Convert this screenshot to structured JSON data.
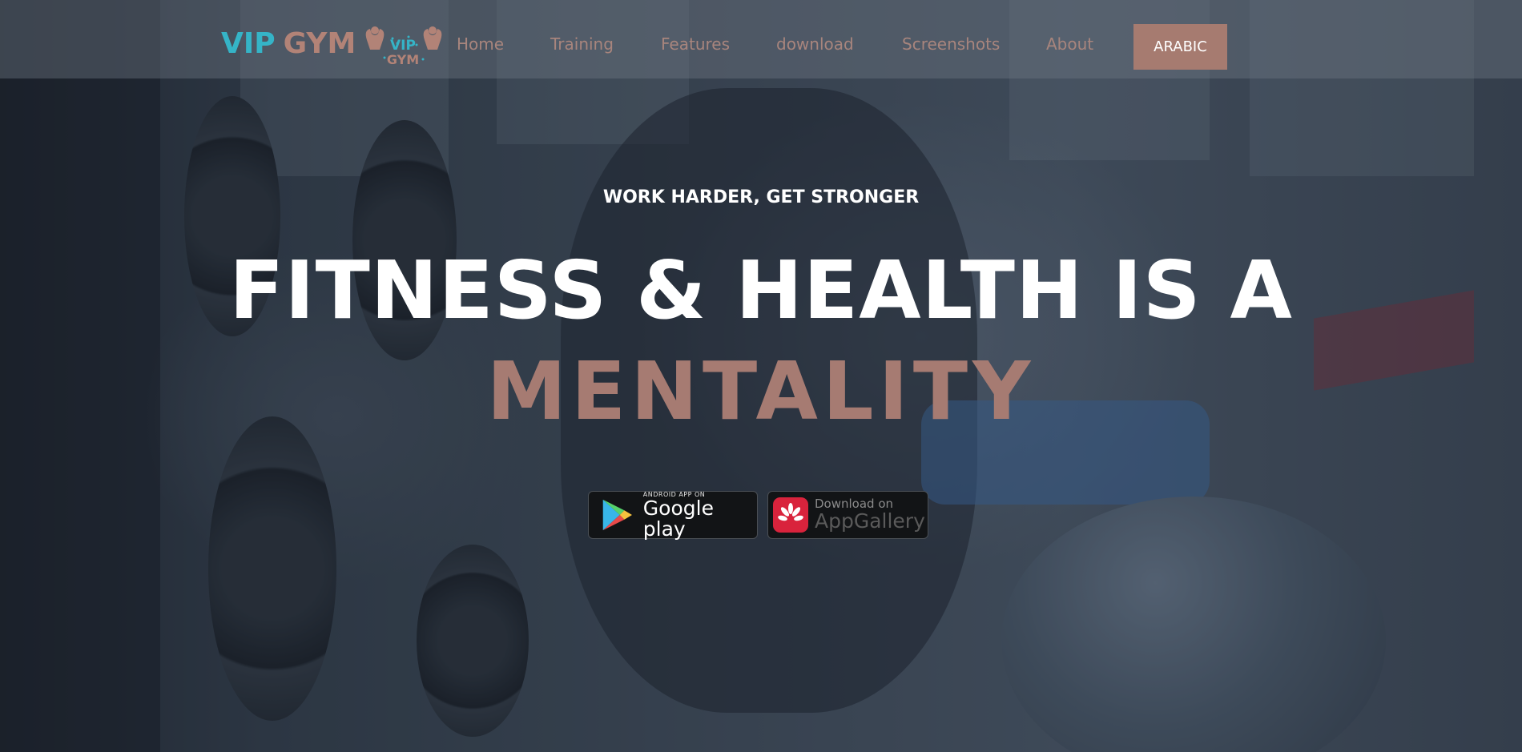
{
  "brand": {
    "name_part1": "VIP",
    "name_part2": "GYM",
    "logo_text_part1": "VIP",
    "logo_text_part2": "GYM"
  },
  "nav": {
    "items": [
      {
        "label": "Home"
      },
      {
        "label": "Training"
      },
      {
        "label": "Features"
      },
      {
        "label": "download"
      },
      {
        "label": "Screenshots"
      },
      {
        "label": "About"
      }
    ],
    "language_button": "ARABIC"
  },
  "hero": {
    "tagline": "WORK HARDER, GET STRONGER",
    "headline": "FITNESS & HEALTH IS A",
    "headline_accent": "MENTALITY"
  },
  "store_badges": {
    "google": {
      "small": "ANDROID APP ON",
      "big": "Google play",
      "icon": "google-play-icon"
    },
    "huawei": {
      "small": "Download on",
      "big": "AppGallery",
      "icon": "huawei-appgallery-icon"
    }
  },
  "colors": {
    "brand_blue": "#35b4c7",
    "brand_rose": "#a67b70",
    "nav_text": "#a8857d",
    "hero_text": "#ffffff"
  }
}
